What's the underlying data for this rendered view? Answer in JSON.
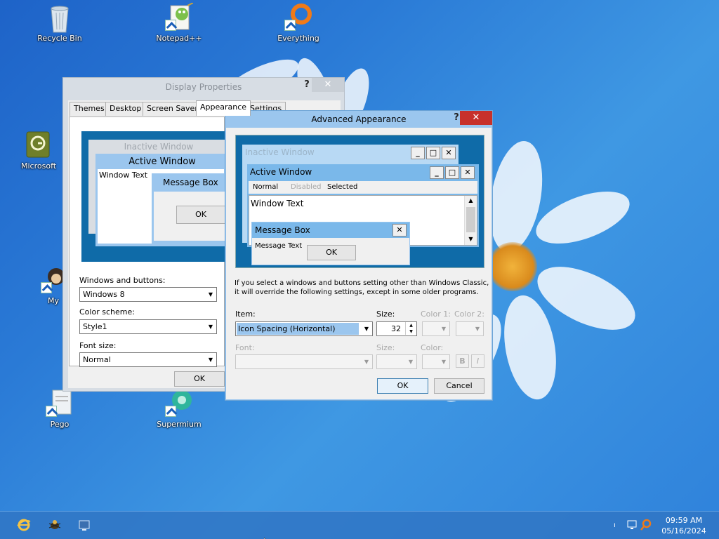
{
  "desktop": {
    "icons": [
      {
        "label": "Recycle Bin"
      },
      {
        "label": "Notepad++"
      },
      {
        "label": "Everything"
      },
      {
        "label": "Microsoft"
      },
      {
        "label": "My"
      },
      {
        "label": "Pego"
      },
      {
        "label": "Supermium"
      }
    ]
  },
  "display_properties": {
    "title": "Display Properties",
    "help": "?",
    "close": "✕",
    "tabs": [
      "Themes",
      "Desktop",
      "Screen Saver",
      "Appearance",
      "Settings"
    ],
    "active_tab": "Appearance",
    "preview": {
      "inactive_window": "Inactive Window",
      "active_window": "Active Window",
      "window_text": "Window Text",
      "message_box": "Message Box",
      "ok": "OK"
    },
    "windows_buttons_label": "Windows and buttons:",
    "windows_buttons_value": "Windows 8",
    "color_scheme_label": "Color scheme:",
    "color_scheme_value": "Style1",
    "font_size_label": "Font size:",
    "font_size_value": "Normal",
    "ok_label": "OK"
  },
  "advanced": {
    "title": "Advanced Appearance",
    "help": "?",
    "close": "✕",
    "preview": {
      "inactive_window": "Inactive Window",
      "active_window": "Active Window",
      "menu_normal": "Normal",
      "menu_disabled": "Disabled",
      "menu_selected": "Selected",
      "window_text": "Window Text",
      "message_box": "Message Box",
      "message_text": "Message Text",
      "ok": "OK"
    },
    "info_text_1": "If you select a windows and buttons setting other than Windows Classic,",
    "info_text_2": "it will override the following settings, except in some older programs.",
    "item_label": "Item:",
    "item_value": "Icon Spacing (Horizontal)",
    "size_label": "Size:",
    "size_value": "32",
    "color1_label": "Color 1:",
    "color2_label": "Color 2:",
    "font_label": "Font:",
    "font_size_label": "Size:",
    "font_color_label": "Color:",
    "bold_label": "B",
    "italic_label": "I",
    "ok_label": "OK",
    "cancel_label": "Cancel"
  },
  "taskbar": {
    "time": "09:59 AM",
    "date": "05/16/2024"
  },
  "colors": {
    "accent_blue": "#9bc6ee",
    "close_red": "#c7312b",
    "preview_bg": "#0f6ba8"
  }
}
